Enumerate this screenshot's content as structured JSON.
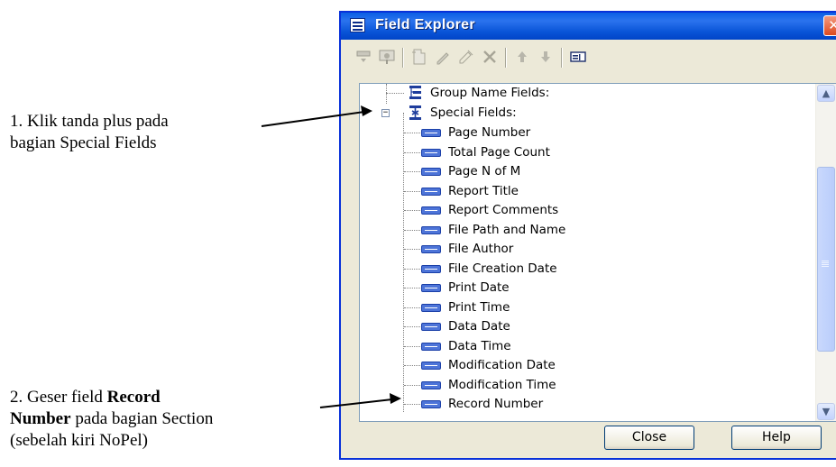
{
  "annotations": {
    "note1_line1": "1. Klik tanda plus pada",
    "note1_line2": "bagian Special Fields",
    "note2_prefix": "2. Geser field ",
    "note2_bold1": "Record",
    "note2_bold2": "Number",
    "note2_rest": " pada bagian Section",
    "note2_line3": "(sebelah kiri NoPel)"
  },
  "window": {
    "title": "Field Explorer",
    "close_glyph": "✕"
  },
  "toolbar": {
    "icons": [
      "insert-to-report-icon",
      "browse-data-icon",
      "new-icon",
      "edit-icon",
      "rename-icon",
      "delete-icon",
      "move-up-icon",
      "move-down-icon",
      "show-field-icon"
    ]
  },
  "tree": {
    "group_name_fields": "Group Name Fields:",
    "special_fields": "Special Fields:",
    "special_expander": "−",
    "items": [
      "Page Number",
      "Total Page Count",
      "Page N of M",
      "Report Title",
      "Report Comments",
      "File Path and Name",
      "File Author",
      "File Creation Date",
      "Print Date",
      "Print Time",
      "Data Date",
      "Data Time",
      "Modification Date",
      "Modification Time",
      "Record Number"
    ]
  },
  "scrollbar": {
    "up_glyph": "▲",
    "down_glyph": "▼"
  },
  "buttons": {
    "close_label": "Close",
    "help_label": "Help"
  },
  "colors": {
    "titlebar": "#0a55d8",
    "field_icon": "#4d74d8",
    "close_button": "#de4a1f"
  }
}
